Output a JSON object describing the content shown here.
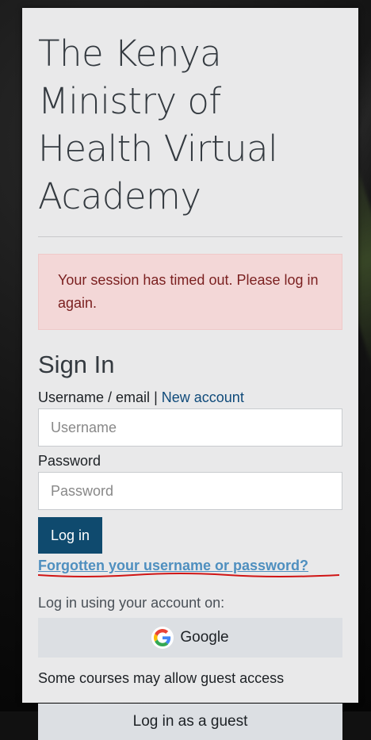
{
  "site_title": "The Kenya Ministry of Health Virtual Academy",
  "alert": {
    "message": "Your session has timed out. Please log in again."
  },
  "signin": {
    "heading": "Sign In",
    "username_label": "Username / email",
    "separator": "|",
    "new_account_link": "New account",
    "username_placeholder": "Username",
    "password_label": "Password",
    "password_placeholder": "Password",
    "login_button": "Log in",
    "forgot_link": "Forgotten your username or password?"
  },
  "external_login": {
    "label": "Log in using your account on:",
    "google_button": "Google",
    "google_icon": "google-logo"
  },
  "guest": {
    "note": "Some courses may allow guest access",
    "button": "Log in as a guest"
  },
  "colors": {
    "primary_button": "#0f4a6e",
    "link": "#0f4a7a",
    "alert_bg": "#f3d7d7",
    "alert_text": "#7a1f1f",
    "annotation_red": "#d01515"
  }
}
